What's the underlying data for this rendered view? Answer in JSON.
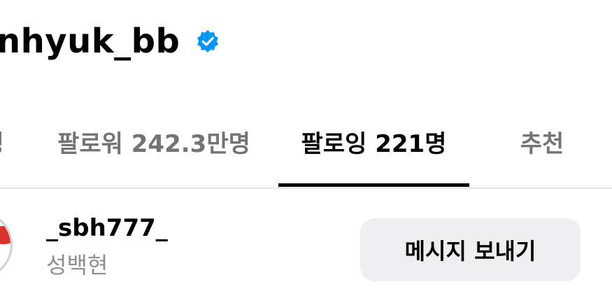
{
  "header": {
    "username": "inhyuk_bb",
    "verified_icon": "verified-badge-icon",
    "verified_color": "#0095f6"
  },
  "tabs": {
    "first_partial": "명",
    "followers": "팔로워 242.3만명",
    "following": "팔로잉 221명",
    "suggested": "추천",
    "active": "following"
  },
  "list": {
    "items": [
      {
        "handle": "_sbh777_",
        "full_name": "성백현",
        "action_label": "메시지 보내기"
      }
    ]
  },
  "colors": {
    "text_primary": "#000000",
    "text_secondary": "#737373",
    "button_bg": "#efeff2",
    "divider": "#e6e6e6"
  }
}
